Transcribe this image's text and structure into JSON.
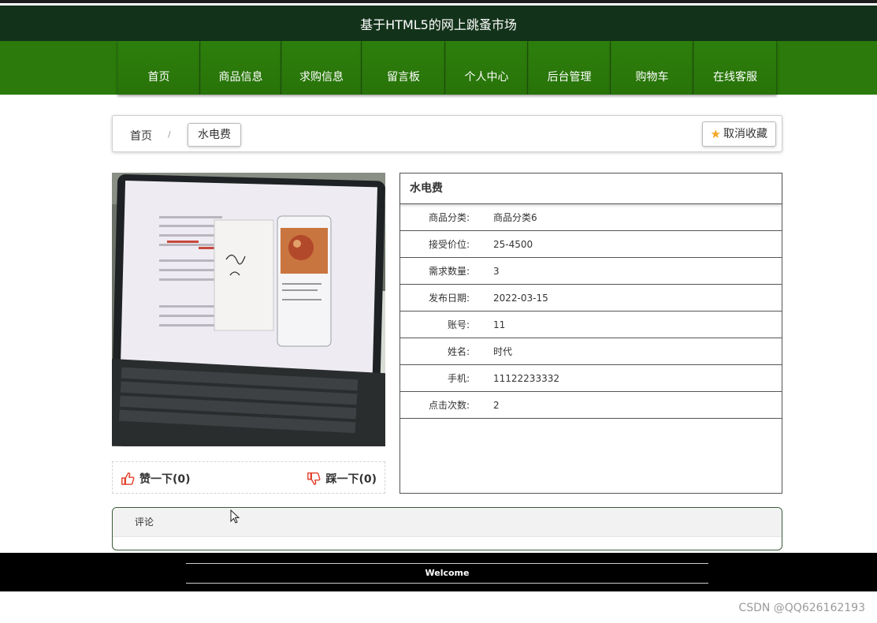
{
  "header": {
    "site_title": "基于HTML5的网上跳蚤市场"
  },
  "nav": {
    "items": [
      {
        "label": "首页"
      },
      {
        "label": "商品信息"
      },
      {
        "label": "求购信息"
      },
      {
        "label": "留言板"
      },
      {
        "label": "个人中心"
      },
      {
        "label": "后台管理"
      },
      {
        "label": "购物车"
      },
      {
        "label": "在线客服"
      }
    ]
  },
  "breadcrumb": {
    "home": "首页",
    "separator": "/",
    "current": "水电费"
  },
  "favorite": {
    "label": "取消收藏",
    "icon": "star-icon",
    "icon_color": "#f5a623"
  },
  "votes": {
    "like_label": "赞一下(0)",
    "dislike_label": "踩一下(0)",
    "icon_color": "#e2412d"
  },
  "detail": {
    "title": "水电费",
    "rows": [
      {
        "label": "商品分类:",
        "value": "商品分类6"
      },
      {
        "label": "接受价位:",
        "value": "25-4500"
      },
      {
        "label": "需求数量:",
        "value": "3"
      },
      {
        "label": "发布日期:",
        "value": "2022-03-15"
      },
      {
        "label": "账号:",
        "value": "11"
      },
      {
        "label": "姓名:",
        "value": "时代"
      },
      {
        "label": "手机:",
        "value": "11122233332"
      },
      {
        "label": "点击次数:",
        "value": "2"
      }
    ]
  },
  "comments": {
    "heading": "评论"
  },
  "footer": {
    "text": "Welcome"
  },
  "watermark": "CSDN @QQ626162193",
  "colors": {
    "header_bg": "#13321a",
    "nav_bg": "#2b7a0b"
  }
}
